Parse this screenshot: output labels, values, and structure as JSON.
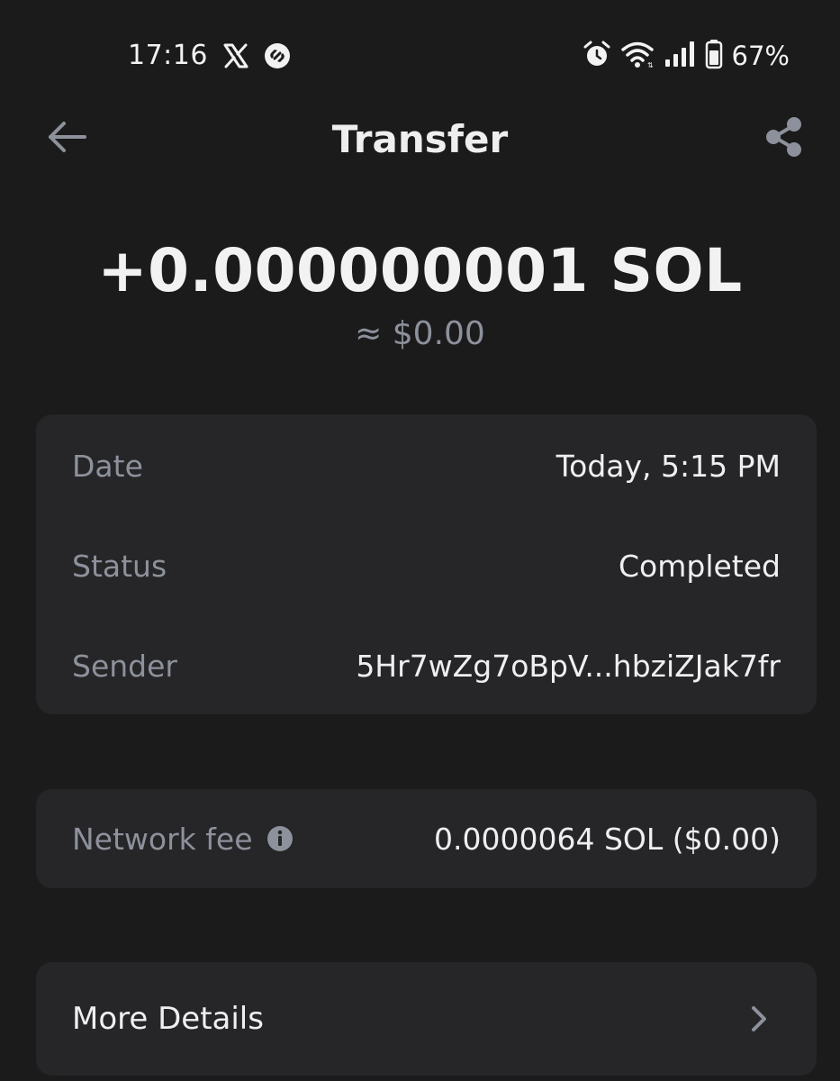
{
  "status_bar": {
    "time": "17:16",
    "left_icons": [
      "x-logo-icon",
      "shazam-icon"
    ],
    "right_icons": [
      "alarm-icon",
      "wifi-icon",
      "signal-icon",
      "battery-icon"
    ],
    "battery_percent": "67%"
  },
  "header": {
    "title": "Transfer",
    "back_icon": "arrow-left-icon",
    "share_icon": "share-icon"
  },
  "transaction": {
    "amount": "+0.000000001 SOL",
    "amount_usd": "≈ $0.00"
  },
  "details": {
    "date_label": "Date",
    "date_value": "Today, 5:15 PM",
    "status_label": "Status",
    "status_value": "Completed",
    "sender_label": "Sender",
    "sender_value": "5Hr7wZg7oBpV...hbziZJak7fr"
  },
  "fee": {
    "label": "Network fee",
    "info_icon": "info-icon",
    "value": "0.0000064 SOL ($0.00)"
  },
  "more": {
    "label": "More Details",
    "chevron_icon": "chevron-right-icon"
  },
  "colors": {
    "background": "#1b1b1c",
    "card": "#262628",
    "label_gray": "#8d919b",
    "text_white": "#efeff1"
  }
}
